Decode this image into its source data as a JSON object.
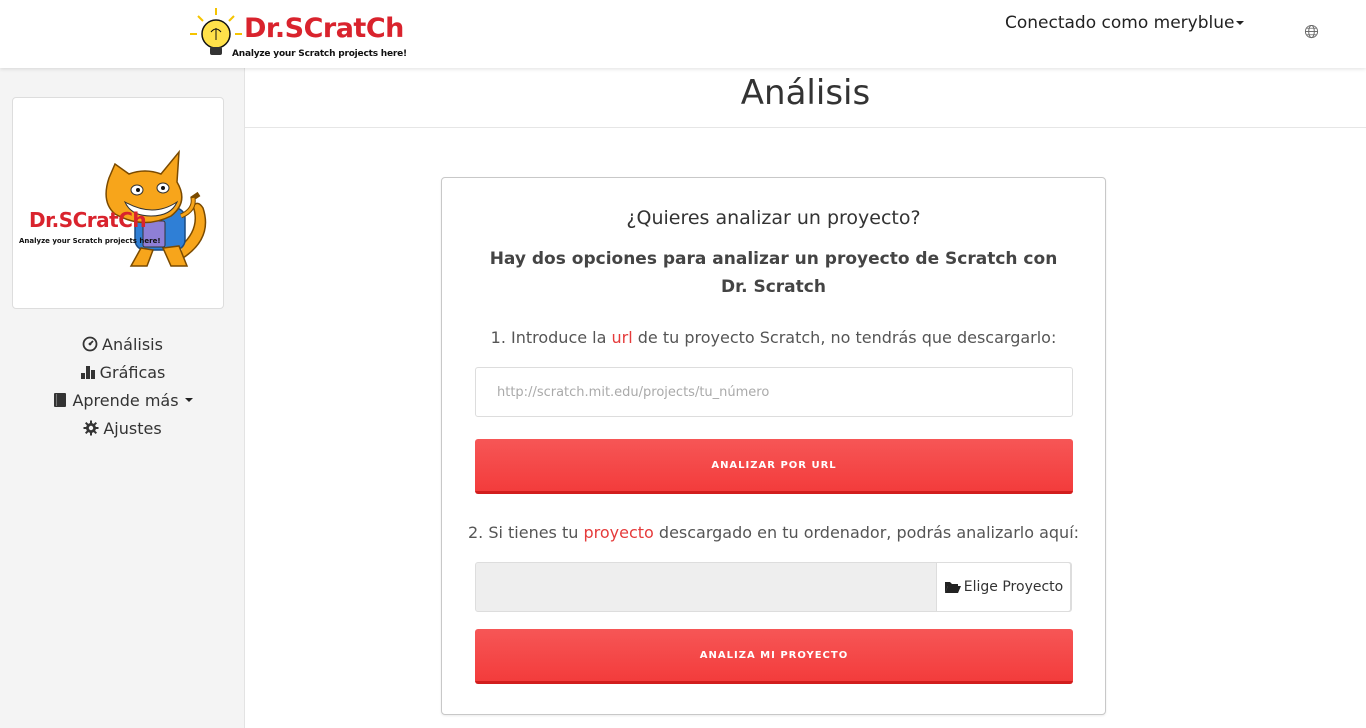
{
  "header": {
    "logo_title": "Dr.SCratCh",
    "logo_subtitle": "Analyze your Scratch projects here!",
    "user_menu": "Conectado como meryblue",
    "language_icon": "globe-icon"
  },
  "sidebar": {
    "card": {
      "title": "Dr.SCratCh",
      "subtitle": "Analyze your Scratch projects here!"
    },
    "items": [
      {
        "label": "Análisis",
        "icon": "dashboard-icon"
      },
      {
        "label": "Gráficas",
        "icon": "bar-chart-icon"
      },
      {
        "label": "Aprende más",
        "icon": "book-icon"
      },
      {
        "label": "Ajustes",
        "icon": "gear-icon"
      }
    ]
  },
  "main": {
    "page_title": "Análisis",
    "panel": {
      "question": "¿Quieres analizar un proyecto?",
      "subtitle": "Hay dos opciones para analizar un proyecto de Scratch con Dr. Scratch",
      "step1_before": "1. Introduce la ",
      "step1_highlight": "url",
      "step1_after": " de tu proyecto Scratch, no tendrás que descargarlo:",
      "url_placeholder": "http://scratch.mit.edu/projects/tu_número",
      "url_button": "ANALIZAR POR URL",
      "step2_before": "2. Si tienes tu ",
      "step2_highlight": "proyecto",
      "step2_after": " descargado en tu ordenador, podrás analizarlo aquí:",
      "file_button": "Elige Proyecto",
      "project_button": "ANALIZA MI PROYECTO"
    }
  },
  "colors": {
    "brand_red": "#d9232d",
    "button_red": "#f33c3c",
    "highlight_red": "#e53b3b"
  }
}
